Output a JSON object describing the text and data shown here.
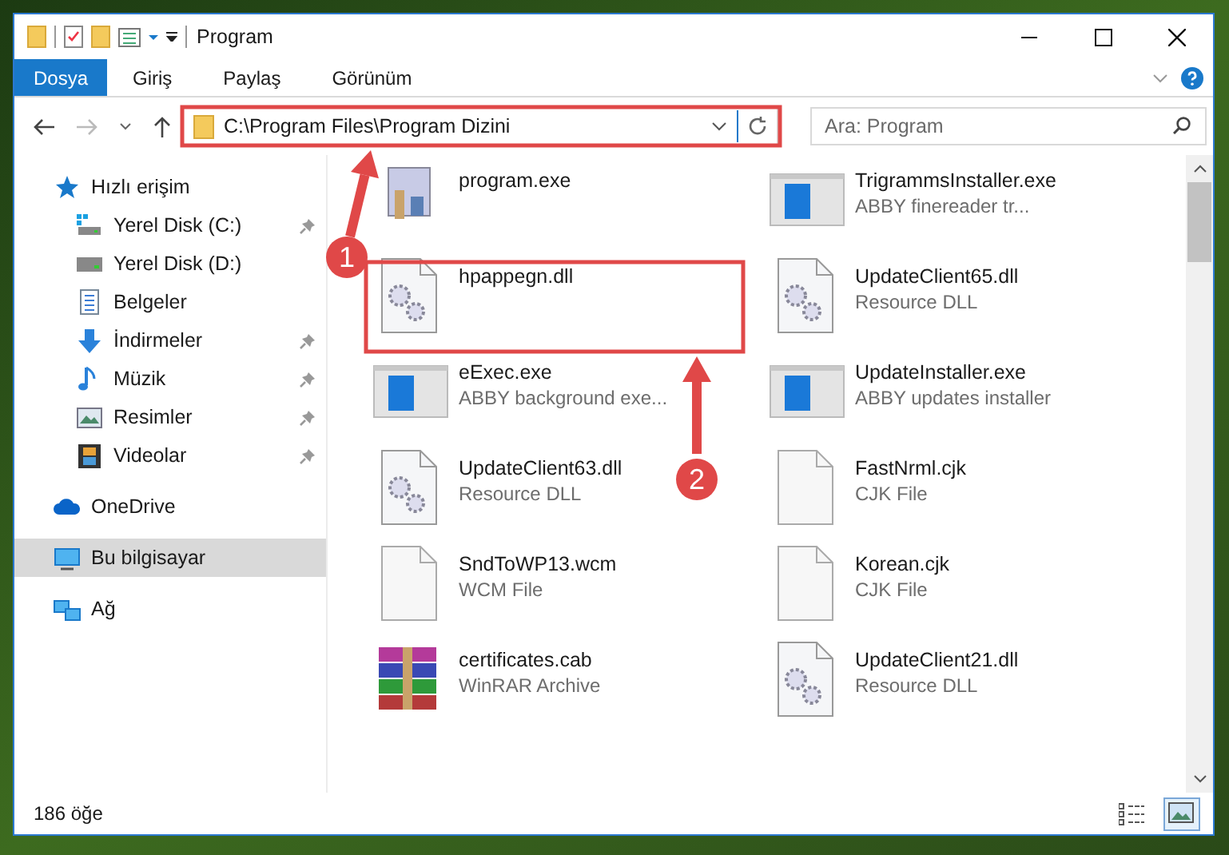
{
  "window": {
    "title": "Program"
  },
  "ribbon": {
    "file_tab": "Dosya",
    "tabs": [
      {
        "label": "Giriş",
        "selected": false
      },
      {
        "label": "Paylaş",
        "selected": false
      },
      {
        "label": "Görünüm",
        "selected": false
      }
    ]
  },
  "address_bar": {
    "path": "C:\\Program Files\\Program Dizini",
    "placeholder": "Ara: Program"
  },
  "nav_pane": [
    {
      "label": "Hızlı erişim",
      "kind": "quick",
      "pinned": false,
      "selected": false
    },
    {
      "label": "Yerel Disk (C:)",
      "kind": "disk-c",
      "pinned": true,
      "selected": false
    },
    {
      "label": "Yerel Disk (D:)",
      "kind": "disk",
      "pinned": false,
      "selected": false
    },
    {
      "label": "Belgeler",
      "kind": "docs",
      "pinned": false,
      "selected": false
    },
    {
      "label": "İndirmeler",
      "kind": "download",
      "pinned": true,
      "selected": false
    },
    {
      "label": "Müzik",
      "kind": "music",
      "pinned": true,
      "selected": false
    },
    {
      "label": "Resimler",
      "kind": "pictures",
      "pinned": true,
      "selected": false
    },
    {
      "label": "Videolar",
      "kind": "videos",
      "pinned": true,
      "selected": false
    },
    {
      "label": "OneDrive",
      "kind": "cloud",
      "pinned": false,
      "selected": false
    },
    {
      "label": "Bu bilgisayar",
      "kind": "pc",
      "pinned": false,
      "selected": true
    },
    {
      "label": "Ağ",
      "kind": "network",
      "pinned": false,
      "selected": false
    }
  ],
  "files": [
    {
      "name": "program.exe",
      "kind": "setup"
    },
    {
      "name": "TrigrammsInstaller.exe",
      "type": "ABBY finereader tr...",
      "kind": "window"
    },
    {
      "name": "hpappegn.dll",
      "kind": "gear-doc"
    },
    {
      "name": "UpdateClient65.dll",
      "type": "Resource DLL",
      "kind": "gear-doc"
    },
    {
      "name": "eExec.exe",
      "type": "ABBY background exe...",
      "kind": "window"
    },
    {
      "name": "UpdateInstaller.exe",
      "type": "ABBY updates installer",
      "kind": "window"
    },
    {
      "name": "UpdateClient63.dll",
      "type": "Resource DLL",
      "kind": "gear-doc"
    },
    {
      "name": "FastNrml.cjk",
      "type": "CJK File",
      "kind": "blank-doc"
    },
    {
      "name": "SndToWP13.wcm",
      "type": "WCM File",
      "kind": "blank-doc"
    },
    {
      "name": "Korean.cjk",
      "type": "CJK File",
      "kind": "blank-doc"
    },
    {
      "name": "certificates.cab",
      "type": "WinRAR Archive",
      "kind": "archive"
    },
    {
      "name": "UpdateClient21.dll",
      "type": "Resource DLL",
      "kind": "gear-doc"
    }
  ],
  "status_bar": {
    "count": "186 öğe",
    "views": [
      {
        "kind": "details",
        "selected": false
      },
      {
        "kind": "large-icons",
        "selected": true
      }
    ]
  },
  "callouts": [
    {
      "label": "1"
    },
    {
      "label": "2"
    }
  ]
}
